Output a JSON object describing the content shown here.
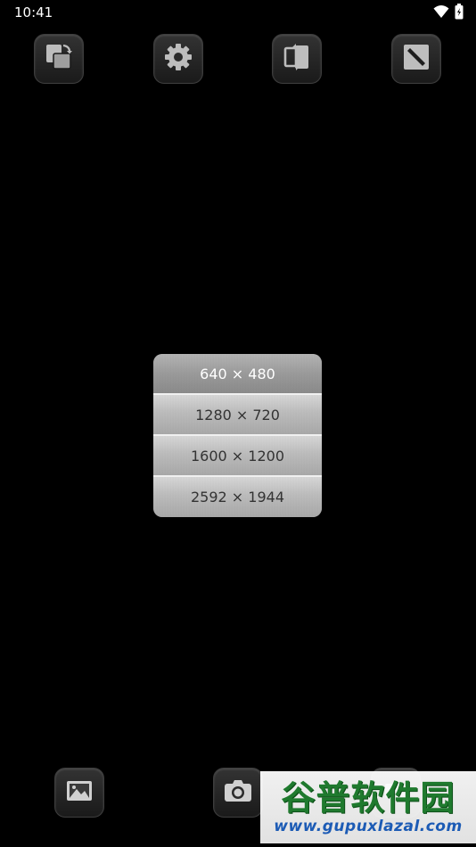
{
  "status_bar": {
    "time": "10:41",
    "icons": [
      "wifi-icon",
      "battery-icon"
    ]
  },
  "toolbar": {
    "buttons": [
      {
        "name": "rotate-icon"
      },
      {
        "name": "gear-icon"
      },
      {
        "name": "flip-camera-icon"
      },
      {
        "name": "fullscreen-icon"
      }
    ]
  },
  "resolution_menu": {
    "options": [
      "640 × 480",
      "1280 × 720",
      "1600 × 1200",
      "2592 × 1944"
    ],
    "selected": "640 × 480"
  },
  "bottom_bar": {
    "buttons": [
      {
        "name": "gallery-icon"
      },
      {
        "name": "camera-icon"
      },
      {
        "name": "video-icon"
      }
    ]
  },
  "watermark": {
    "title": "谷普软件园",
    "url": "www.gupuxlazal.com"
  }
}
